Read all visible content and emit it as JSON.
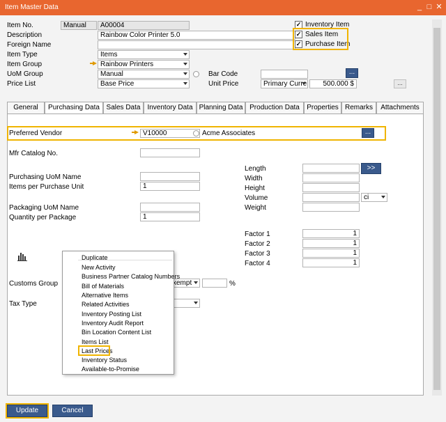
{
  "window": {
    "title": "Item Master Data"
  },
  "header": {
    "item_no_label": "Item No.",
    "item_no_series": "Manual",
    "item_no_value": "A00004",
    "description_label": "Description",
    "description_value": "Rainbow Color Printer 5.0",
    "foreign_name_label": "Foreign Name",
    "item_type_label": "Item Type",
    "item_type_value": "Items",
    "item_group_label": "Item Group",
    "item_group_value": "Rainbow Printers",
    "uom_group_label": "UoM Group",
    "uom_group_value": "Manual",
    "price_list_label": "Price List",
    "price_list_value": "Base Price",
    "bar_code_label": "Bar Code",
    "unit_price_label": "Unit Price",
    "unit_price_currency_type": "Primary Currer",
    "unit_price_value": "500.000 $",
    "inventory_item_label": "Inventory Item",
    "sales_item_label": "Sales Item",
    "purchase_item_label": "Purchase Item",
    "ellipsis": "..."
  },
  "tabs": [
    {
      "label": "General"
    },
    {
      "label": "Purchasing Data"
    },
    {
      "label": "Sales Data"
    },
    {
      "label": "Inventory Data"
    },
    {
      "label": "Planning Data"
    },
    {
      "label": "Production Data"
    },
    {
      "label": "Properties"
    },
    {
      "label": "Remarks"
    },
    {
      "label": "Attachments"
    }
  ],
  "purchasing": {
    "preferred_vendor_label": "Preferred Vendor",
    "preferred_vendor_code": "V10000",
    "preferred_vendor_name": "Acme Associates",
    "mfr_catalog_label": "Mfr Catalog No.",
    "purchasing_uom_label": "Purchasing UoM Name",
    "items_per_purchase_unit_label": "Items per Purchase Unit",
    "items_per_purchase_unit_value": "1",
    "packaging_uom_label": "Packaging UoM Name",
    "qty_per_package_label": "Quantity per Package",
    "qty_per_package_value": "1",
    "customs_group_label": "Customs Group",
    "customs_group_value": "xempt",
    "percent_sign": "%",
    "tax_type_label": "Tax Type",
    "length_label": "Length",
    "width_label": "Width",
    "height_label": "Height",
    "volume_label": "Volume",
    "volume_unit": "ci",
    "weight_label": "Weight",
    "dim_button": ">>",
    "factor1_label": "Factor 1",
    "factor2_label": "Factor 2",
    "factor3_label": "Factor 3",
    "factor4_label": "Factor 4",
    "factor1_value": "1",
    "factor2_value": "1",
    "factor3_value": "1",
    "factor4_value": "1"
  },
  "context_menu": {
    "items": [
      "Duplicate",
      "New Activity",
      "Business Partner Catalog Numbers",
      "Bill of Materials",
      "Alternative Items",
      "Related Activities",
      "Inventory Posting List",
      "Inventory Audit Report",
      "Bin Location Content List",
      "Items List",
      "Last Prices",
      "Inventory Status",
      "Available-to-Promise"
    ]
  },
  "footer": {
    "update_label": "Update",
    "cancel_label": "Cancel"
  },
  "colors": {
    "title_bar": "#e8662f",
    "highlight": "#f0b400",
    "button": "#3a5a8c"
  }
}
